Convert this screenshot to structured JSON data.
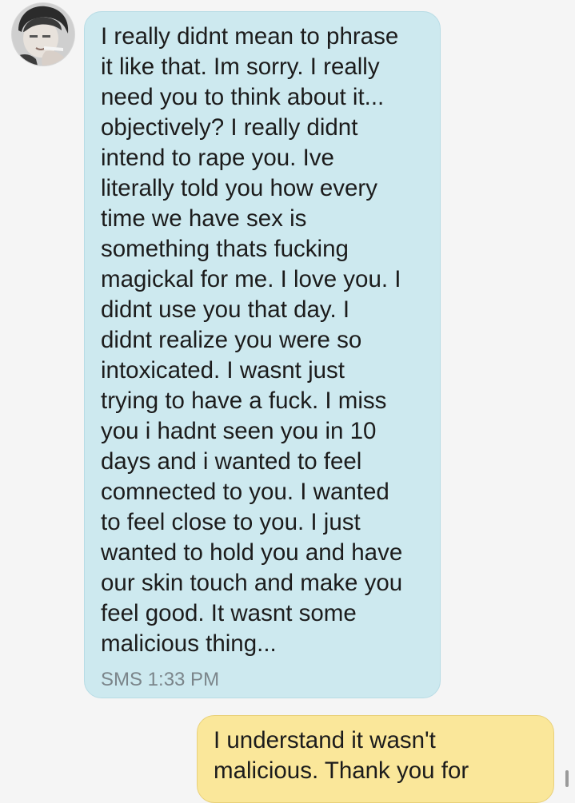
{
  "conversation": {
    "incoming": {
      "lines": [
        "I really didnt mean to phrase",
        "it like that. Im sorry. I really",
        "need you to think about it...",
        "objectively? I really didnt",
        "intend to rape you. Ive",
        "literally told you how every",
        "time we have sex is",
        "something thats fucking",
        "magickal for me. I love you. I",
        "didnt use you that day. I",
        "didnt realize you were so",
        "intoxicated. I wasnt just",
        "trying to have a fuck. I miss",
        "you i hadnt seen you in 10",
        "days and i wanted to feel",
        "comnected to you. I wanted",
        "to feel close to you. I just",
        "wanted to hold you and have",
        "our skin touch and make you",
        "feel good. It wasnt some",
        "malicious thing..."
      ],
      "meta": "SMS 1:33 PM",
      "bubble_color": "#cde9ef",
      "avatar_icon": "contact-photo-icon"
    },
    "outgoing": {
      "lines": [
        "I understand it wasn't",
        "malicious. Thank you for"
      ],
      "bubble_color": "#fae79a"
    }
  }
}
